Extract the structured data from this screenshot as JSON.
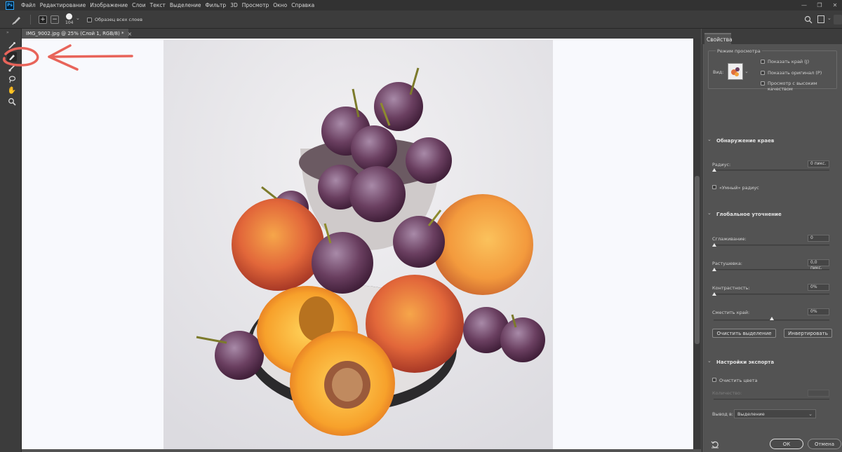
{
  "menu": {
    "logo": "Ps",
    "items": [
      "Файл",
      "Редактирование",
      "Изображение",
      "Слои",
      "Текст",
      "Выделение",
      "Фильтр",
      "3D",
      "Просмотр",
      "Окно",
      "Справка"
    ]
  },
  "options": {
    "brush_size": "104",
    "sample_all_layers": "Образец всех слоев"
  },
  "document": {
    "tab_title": "IMG_9002.jpg @ 25% (Слой 1, RGB/8) *",
    "close": "×"
  },
  "panel": {
    "tab": "Свойства",
    "view_mode": {
      "title": "Режим просмотра",
      "view_label": "Вид:",
      "show_edge": "Показать край (J)",
      "show_original": "Показать оригинал (P)",
      "high_quality": "Просмотр с высоким качеством"
    },
    "edge_detection": {
      "title": "Обнаружение краев",
      "radius_label": "Радиус:",
      "radius_value": "0 пикс.",
      "radius_level": 0,
      "smart_radius": "«Умный» радиус"
    },
    "global_refine": {
      "title": "Глобальное уточнение",
      "smooth_label": "Сглаживание:",
      "smooth_value": "0",
      "smooth_level": 0,
      "feather_label": "Растушевка:",
      "feather_value": "0,0 пикс.",
      "feather_level": 0,
      "contrast_label": "Контрастность:",
      "contrast_value": "0%",
      "contrast_level": 0,
      "shift_label": "Сместить край:",
      "shift_value": "0%",
      "shift_level": 0.5,
      "clear_selection": "Очистить выделение",
      "invert": "Инвертировать"
    },
    "export": {
      "title": "Настройки экспорта",
      "decontaminate": "Очистить цвета",
      "amount_label": "Количество:",
      "output_label": "Вывод в:",
      "output_value": "Выделение"
    },
    "ok": "ОК",
    "cancel": "Отмена"
  },
  "colors": {
    "annotation": "#e8645a",
    "ui_dark": "#323232",
    "panel": "#535353"
  }
}
